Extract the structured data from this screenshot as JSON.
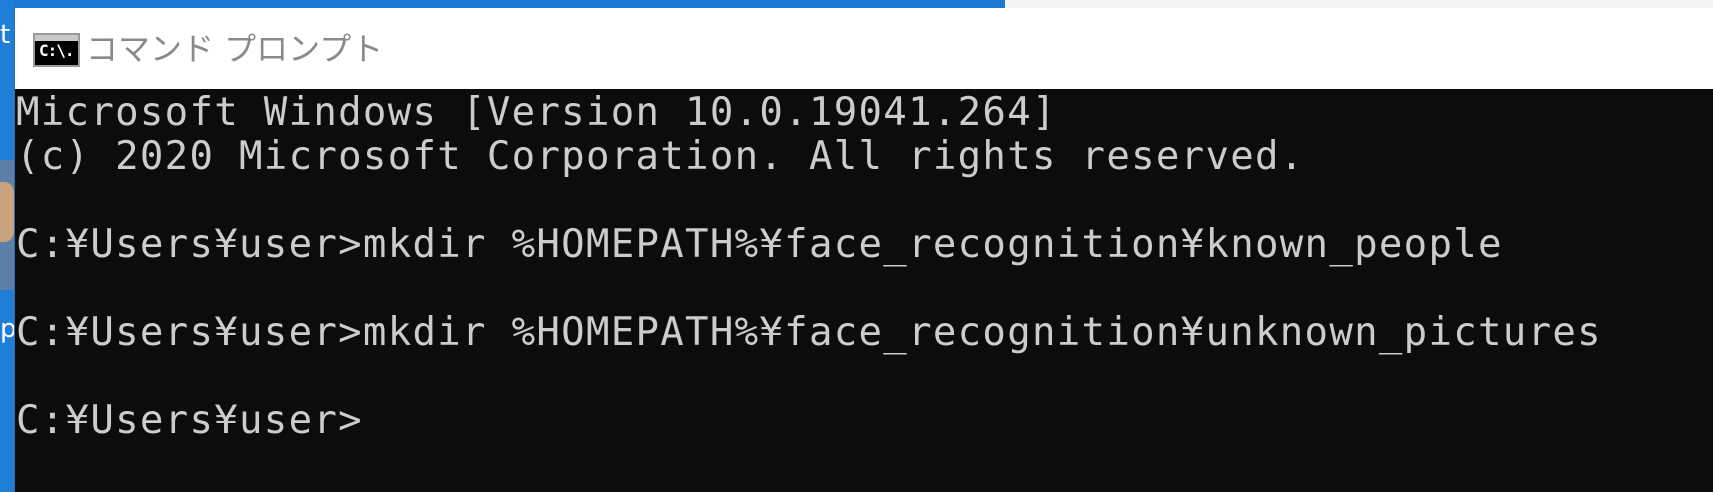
{
  "desktop": {
    "icon_letter_top": "t",
    "icon_letter_bottom": "p",
    "accent_color": "#1e79d4"
  },
  "window": {
    "title": "コマンド プロンプト",
    "app_icon": "cmd-app-icon",
    "app_icon_text": "C:\\.",
    "titlebar_color": "#ffffff",
    "console_background": "#0c0c0c",
    "console_text_color": "#cccccc"
  },
  "console": {
    "lines": [
      "Microsoft Windows [Version 10.0.19041.264]",
      "(c) 2020 Microsoft Corporation. All rights reserved.",
      "",
      "C:¥Users¥user>mkdir %HOMEPATH%¥face_recognition¥known_people",
      "",
      "C:¥Users¥user>mkdir %HOMEPATH%¥face_recognition¥unknown_pictures",
      "",
      "C:¥Users¥user>"
    ]
  }
}
